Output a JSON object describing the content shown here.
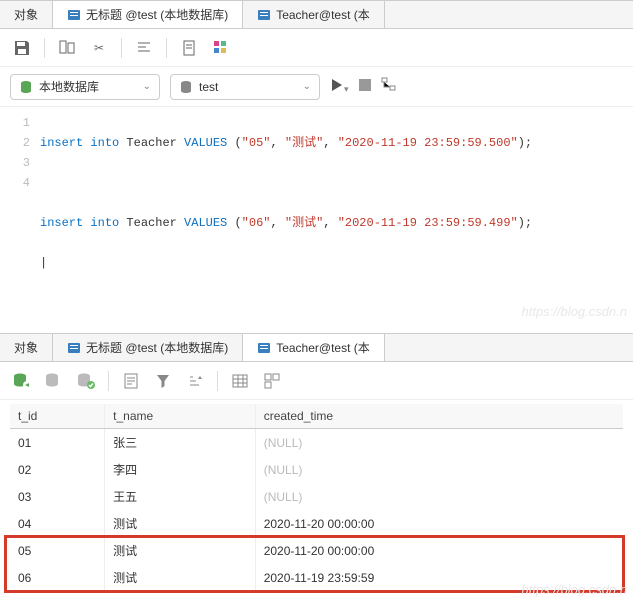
{
  "top_tabs": {
    "objects": "对象",
    "untitled": "无标题 @test (本地数据库)",
    "teacher": "Teacher@test (本"
  },
  "selectors": {
    "db": "本地数据库",
    "schema": "test"
  },
  "sql": {
    "l1_k1": "insert",
    "l1_k2": "into",
    "l1_t": " Teacher ",
    "l1_v": "VALUES",
    "l1_p1": " (",
    "l1_s1": "\"05\"",
    "l1_c1": ", ",
    "l1_s2": "\"测试\"",
    "l1_c2": ", ",
    "l1_s3": "\"2020-11-19 23:59:59.500\"",
    "l1_p2": ");",
    "l3_k1": "insert",
    "l3_k2": "into",
    "l3_t": " Teacher ",
    "l3_v": "VALUES",
    "l3_p1": " (",
    "l3_s1": "\"06\"",
    "l3_c1": ", ",
    "l3_s2": "\"测试\"",
    "l3_c2": ", ",
    "l3_s3": "\"2020-11-19 23:59:59.499\"",
    "l3_p2": ");"
  },
  "gutter": {
    "n1": "1",
    "n2": "2",
    "n3": "3",
    "n4": "4"
  },
  "bottom_tabs": {
    "objects": "对象",
    "untitled": "无标题 @test (本地数据库)",
    "teacher": "Teacher@test (本"
  },
  "columns": {
    "c0": "t_id",
    "c1": "t_name",
    "c2": "created_time"
  },
  "rows": [
    {
      "id": "01",
      "name": "张三",
      "ct": "(NULL)",
      "nullct": true
    },
    {
      "id": "02",
      "name": "李四",
      "ct": "(NULL)",
      "nullct": true
    },
    {
      "id": "03",
      "name": "王五",
      "ct": "(NULL)",
      "nullct": true
    },
    {
      "id": "04",
      "name": "测试",
      "ct": "2020-11-20 00:00:00"
    },
    {
      "id": "05",
      "name": "测试",
      "ct": "2020-11-20 00:00:00"
    },
    {
      "id": "06",
      "name": "测试",
      "ct": "2020-11-19 23:59:59"
    }
  ],
  "watermark": "https://blog.csdn.n"
}
